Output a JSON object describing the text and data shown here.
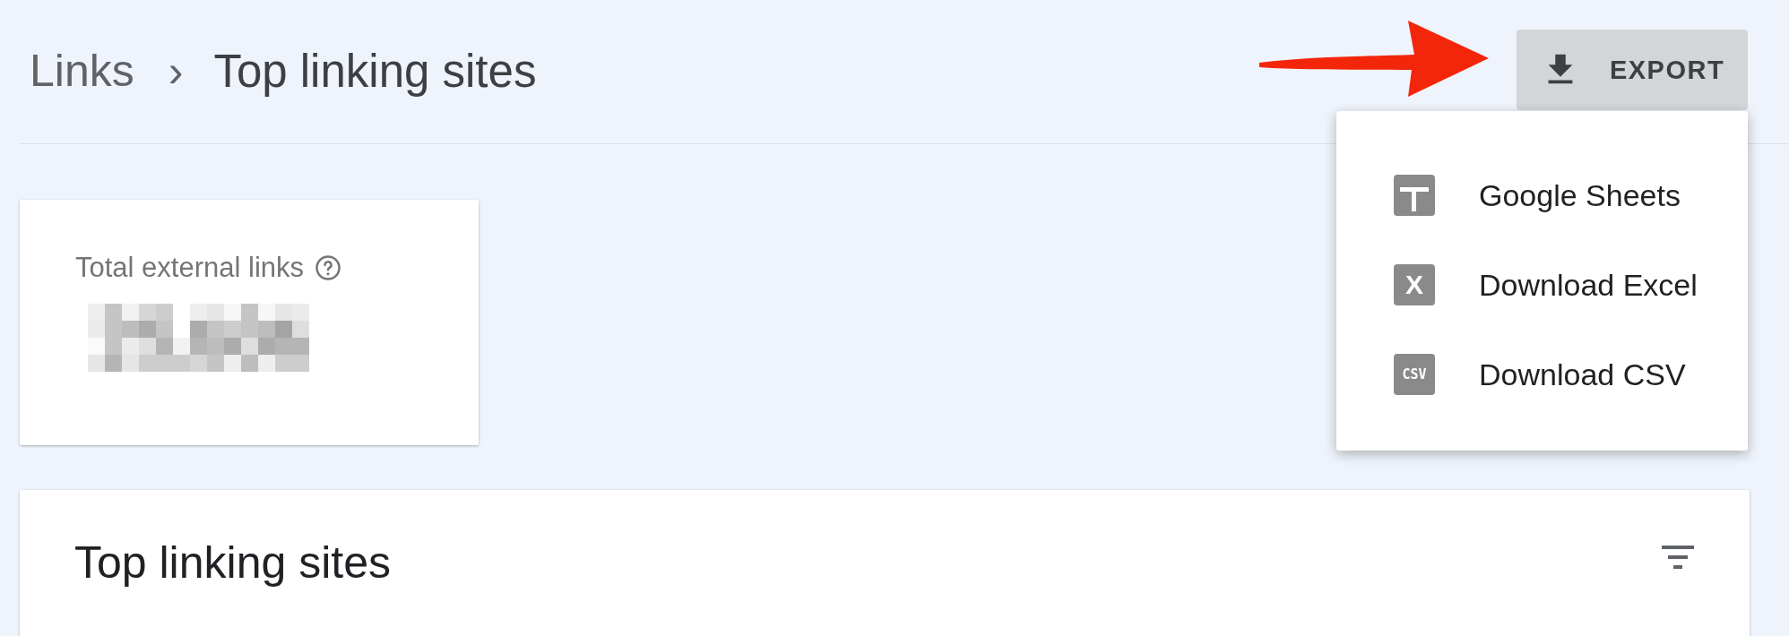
{
  "breadcrumb": {
    "parent": "Links",
    "separator": "›",
    "current": "Top linking sites"
  },
  "export_button": {
    "label": "EXPORT"
  },
  "export_menu": {
    "items": [
      {
        "kind": "sheets",
        "label": "Google Sheets"
      },
      {
        "kind": "excel",
        "label": "Download Excel",
        "icon_text": "X"
      },
      {
        "kind": "csv",
        "label": "Download CSV",
        "icon_text": "CSV"
      }
    ]
  },
  "summary_card": {
    "label": "Total external links",
    "value_hidden": true
  },
  "table_card": {
    "title": "Top linking sites"
  }
}
